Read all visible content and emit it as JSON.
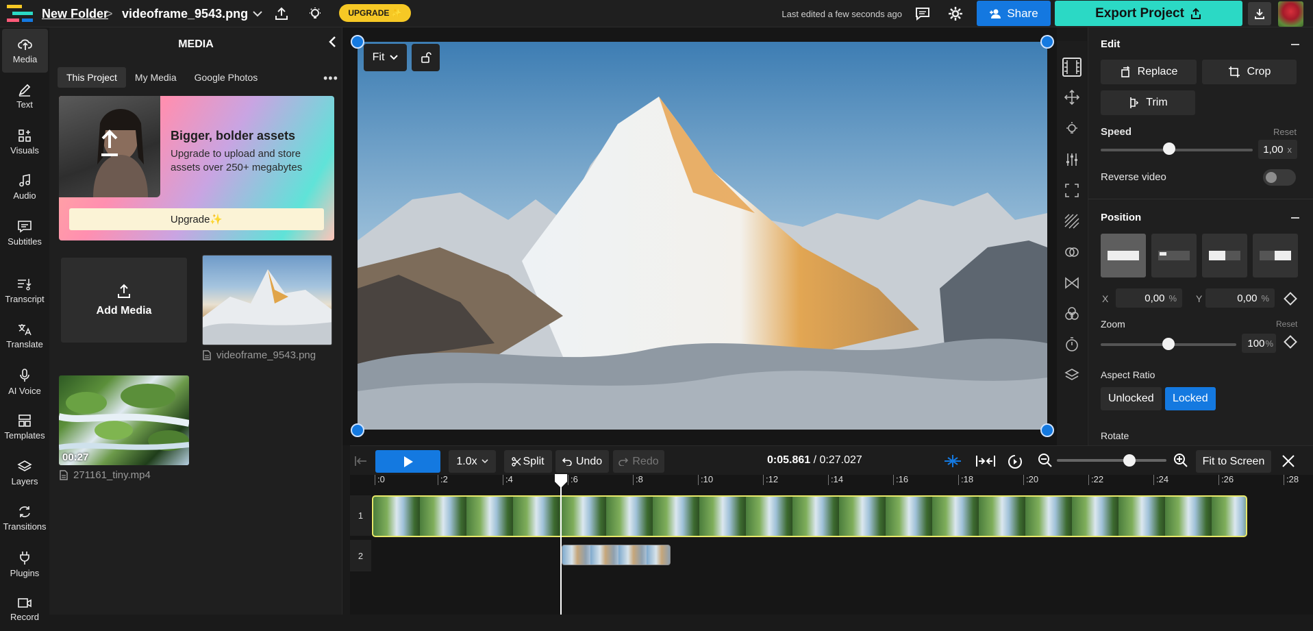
{
  "header": {
    "folder": "New Folder",
    "separator": ">",
    "file_name": "videoframe_9543.png",
    "upgrade_label": "UPGRADE ✨",
    "last_edited": "Last edited a few seconds ago",
    "share_label": "Share",
    "export_label": "Export Project"
  },
  "nav": {
    "items": [
      {
        "label": "Media",
        "icon": "upload-cloud-icon"
      },
      {
        "label": "Text",
        "icon": "pencil-icon"
      },
      {
        "label": "Visuals",
        "icon": "shapes-icon"
      },
      {
        "label": "Audio",
        "icon": "music-note-icon"
      },
      {
        "label": "Subtitles",
        "icon": "subtitles-icon"
      },
      {
        "label": "Transcript",
        "icon": "transcript-icon"
      },
      {
        "label": "Translate",
        "icon": "translate-icon"
      },
      {
        "label": "AI Voice",
        "icon": "microphone-icon"
      },
      {
        "label": "Templates",
        "icon": "templates-icon"
      },
      {
        "label": "Layers",
        "icon": "layers-icon"
      },
      {
        "label": "Transitions",
        "icon": "transitions-icon"
      },
      {
        "label": "Plugins",
        "icon": "plug-icon"
      },
      {
        "label": "Record",
        "icon": "camera-icon"
      }
    ]
  },
  "media": {
    "title": "MEDIA",
    "tabs": [
      "This Project",
      "My Media",
      "Google Photos"
    ],
    "more": "•••",
    "promo": {
      "title": "Bigger, bolder assets",
      "description": "Upgrade to upload and store assets over 250+ megabytes",
      "button": "Upgrade✨"
    },
    "add_media": "Add Media",
    "files": [
      {
        "name": "videoframe_9543.png"
      },
      {
        "name": "271161_tiny.mp4",
        "duration": "00:27"
      }
    ]
  },
  "canvas": {
    "fit_label": "Fit"
  },
  "properties": {
    "edit_title": "Edit",
    "replace": "Replace",
    "crop": "Crop",
    "trim": "Trim",
    "speed_label": "Speed",
    "speed_reset": "Reset",
    "speed_value": "1,00",
    "speed_unit": "x",
    "speed_level": 0.45,
    "reverse_label": "Reverse video",
    "reverse_on": false,
    "position_title": "Position",
    "x_label": "X",
    "x_value": "0,00",
    "y_label": "Y",
    "y_value": "0,00",
    "percent": "%",
    "zoom_label": "Zoom",
    "zoom_reset": "Reset",
    "zoom_value": "100",
    "zoom_level": 0.5,
    "aspect_title": "Aspect Ratio",
    "aspect_unlocked": "Unlocked",
    "aspect_locked": "Locked",
    "rotate_title": "Rotate"
  },
  "timeline": {
    "speed": "1.0x",
    "split": "Split",
    "undo": "Undo",
    "redo": "Redo",
    "current_time": "0:05.861",
    "time_sep": "/",
    "total_time": "0:27.027",
    "fit_screen": "Fit to Screen",
    "ticks": [
      ":0",
      ":2",
      ":4",
      ":6",
      ":8",
      ":10",
      ":12",
      ":14",
      ":16",
      ":18",
      ":20",
      ":22",
      ":24",
      ":26",
      ":28"
    ],
    "tracks": [
      "1",
      "2"
    ],
    "zoom_level": 0.66
  },
  "colors": {
    "accent": "#1479e0",
    "export": "#2bd9c5",
    "upgrade": "#f6c825",
    "clip_border": "#e8e86a"
  }
}
